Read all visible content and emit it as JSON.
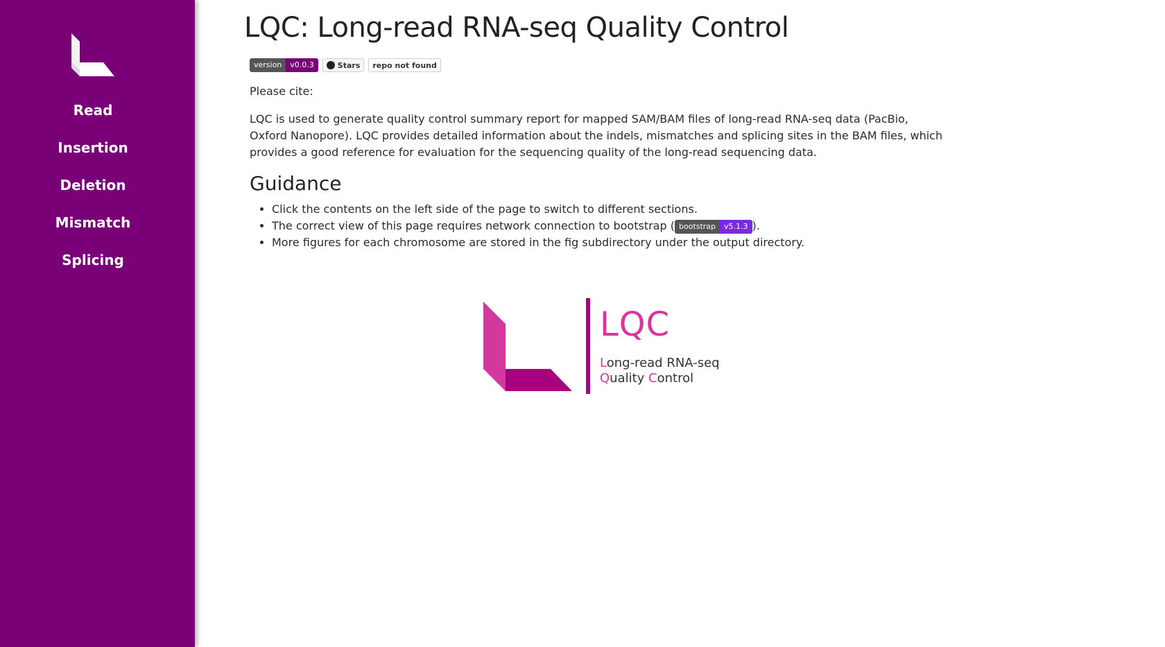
{
  "sidebar": {
    "items": [
      {
        "label": "Read"
      },
      {
        "label": "Insertion"
      },
      {
        "label": "Deletion"
      },
      {
        "label": "Mismatch"
      },
      {
        "label": "Splicing"
      }
    ]
  },
  "header": {
    "title": "LQC: Long-read RNA-seq Quality Control"
  },
  "badges": {
    "version_label": "version",
    "version_value": "v0.0.3",
    "stars_label": "Stars",
    "repo_label": "repo not found"
  },
  "content": {
    "cite": "Please cite:",
    "description": "LQC is used to generate quality control summary report for mapped SAM/BAM files of long-read RNA-seq data (PacBio, Oxford Nanopore). LQC provides detailed information about the indels, mismatches and splicing sites in the BAM files, which provides a good reference for evaluation for the sequencing quality of the long-read sequencing data.",
    "guidance_title": "Guidance",
    "guidance": {
      "item1": "Click the contents on the left side of the page to switch to different sections.",
      "item2_pre": "The correct view of this page requires network connection to bootstrap (",
      "item2_badge_label": "bootstrap",
      "item2_badge_value": "v5.1.3",
      "item2_post": ").",
      "item3": "More figures for each chromosome are stored in the fig subdirectory under the output directory."
    }
  },
  "logo": {
    "title": "LQC",
    "sub_line1_first": "L",
    "sub_line1_rest": "ong-read RNA-seq",
    "sub_line2_first": "Q",
    "sub_line2_mid": "uality ",
    "sub_line2_c": "C",
    "sub_line2_rest": "ontrol"
  },
  "colors": {
    "sidebar": "#7a0078",
    "accent": "#d4389c",
    "bootstrap": "#7a2be2"
  }
}
